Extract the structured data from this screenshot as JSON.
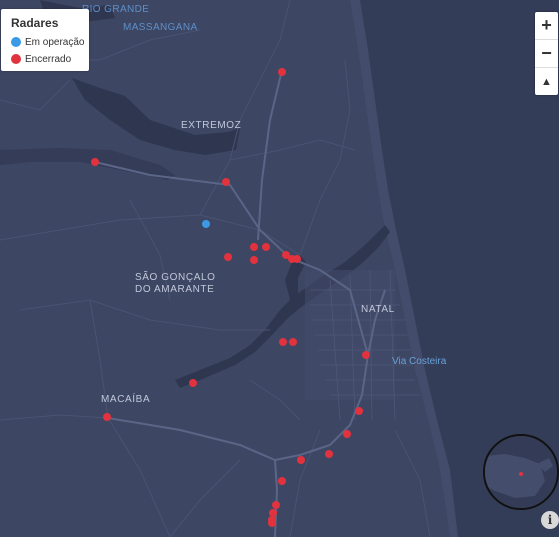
{
  "legend": {
    "title": "Radares",
    "items": [
      {
        "label": "Em operação",
        "color": "#3b99e6"
      },
      {
        "label": "Encerrado",
        "color": "#e2323e"
      }
    ]
  },
  "places": {
    "rio_grande": "RIO GRANDE",
    "massangana": "MASSANGANA",
    "extremoz": "EXTREMOZ",
    "sao_goncalo_1": "SÃO GONÇALO",
    "sao_goncalo_2": "DO AMARANTE",
    "natal": "NATAL",
    "macaiba": "MACAÍBA",
    "via_costeira": "Via Costeira"
  },
  "controls": {
    "zoom_in": "+",
    "zoom_out": "−",
    "reset_north": "▲",
    "info": "i"
  },
  "colors": {
    "land": "#3d4663",
    "sea": "#343d58",
    "river": "#2f3650",
    "road_major": "#596384",
    "road_minor": "#4a5372",
    "operating": "#3b99e6",
    "closed": "#e2323e"
  },
  "radars": [
    {
      "status": "closed",
      "place": "near Massangana"
    },
    {
      "status": "closed",
      "place": "west of Extremoz"
    },
    {
      "status": "closed",
      "place": "south of Extremoz"
    },
    {
      "status": "operating",
      "place": "north of São Gonçalo do Amarante"
    },
    {
      "status": "closed",
      "place": "São Gonçalo do Amarante"
    },
    {
      "status": "closed",
      "place": "São Gonçalo do Amarante"
    },
    {
      "status": "closed",
      "place": "São Gonçalo do Amarante"
    },
    {
      "status": "closed",
      "place": "São Gonçalo do Amarante"
    },
    {
      "status": "closed",
      "place": "north Natal"
    },
    {
      "status": "closed",
      "place": "north Natal"
    },
    {
      "status": "closed",
      "place": "north Natal"
    },
    {
      "status": "closed",
      "place": "west Natal"
    },
    {
      "status": "closed",
      "place": "west Natal"
    },
    {
      "status": "closed",
      "place": "Natal"
    },
    {
      "status": "closed",
      "place": "east of Macaíba"
    },
    {
      "status": "closed",
      "place": "Macaíba"
    },
    {
      "status": "closed",
      "place": "south Natal"
    },
    {
      "status": "closed",
      "place": "south Natal"
    },
    {
      "status": "closed",
      "place": "south Natal"
    },
    {
      "status": "closed",
      "place": "south Natal"
    },
    {
      "status": "closed",
      "place": "BR-101 south"
    },
    {
      "status": "closed",
      "place": "BR-101 south"
    },
    {
      "status": "closed",
      "place": "BR-101 south"
    },
    {
      "status": "closed",
      "place": "BR-101 south"
    },
    {
      "status": "closed",
      "place": "BR-101 south"
    }
  ]
}
